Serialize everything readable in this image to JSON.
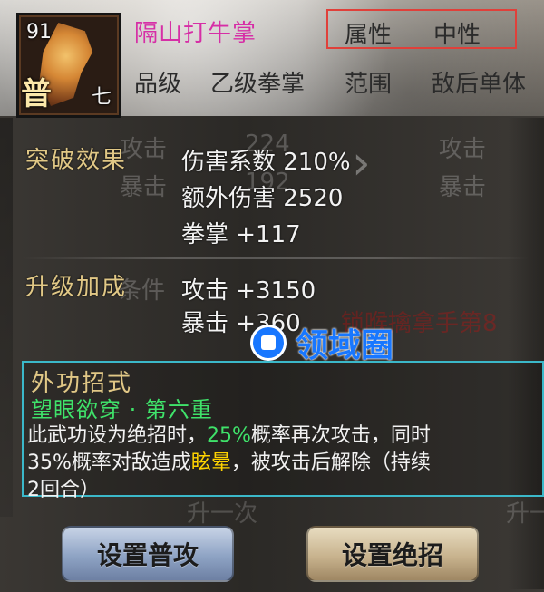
{
  "skill": {
    "level": "91",
    "grade": "普",
    "rank": "七",
    "name": "隔山打牛掌",
    "attribute_label": "属性",
    "attribute_value": "中性"
  },
  "meta": {
    "grade_label": "品级",
    "grade_value": "乙级拳掌",
    "range_label": "范围",
    "range_value": "敌后单体"
  },
  "background_text": {
    "left_attack": "攻击",
    "left_attack_val": "224",
    "left_crit": "暴击",
    "left_crit_val": "192",
    "right_attack": "攻击",
    "right_crit": "暴击",
    "left_condition": "条件",
    "right_skill": "锁喉擒拿手第8",
    "bottom_left_button": "升一次",
    "bottom_right_button": "升一"
  },
  "breakthrough": {
    "title": "突破效果",
    "lines": [
      "伤害系数 210%",
      "额外伤害 2520",
      "拳掌 +117"
    ]
  },
  "upgrade": {
    "title": "升级加成",
    "lines": [
      "攻击 +3150",
      "暴击 +360"
    ]
  },
  "external": {
    "title": "外功招式",
    "subtitle": "望眼欲穿 · 第六重",
    "desc_part1": "此武功设为绝招时，",
    "pct1": "25%",
    "desc_part2": "概率再次攻击，同时",
    "desc_part3": "35%概率对敌造成",
    "status": "眩晕",
    "desc_part4": "，被攻击后解除（持续",
    "desc_part5": "2回合）"
  },
  "watermark": {
    "text": "领域圈"
  },
  "buttons": {
    "set_normal": "设置普攻",
    "set_ultimate": "设置绝招"
  },
  "colors": {
    "skill_name": "#d62ea6",
    "highlight_green": "#3fe26a",
    "highlight_yellow": "#ffd400",
    "box_border": "#3bb8c9",
    "attr_box_border": "#e0403a",
    "watermark_blue": "#1877ff"
  }
}
